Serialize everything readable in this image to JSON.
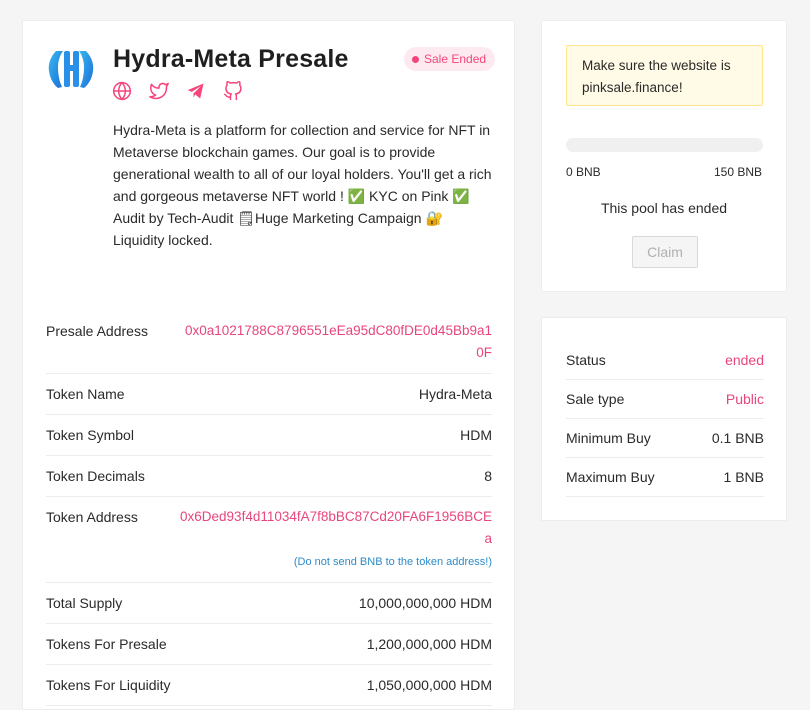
{
  "header": {
    "title": "Hydra-Meta Presale",
    "badge": "Sale Ended"
  },
  "colors": {
    "accent": "#f5457b",
    "link": "#2e8bc9",
    "warning_bg": "#fffbe6"
  },
  "socials": [
    "globe-icon",
    "twitter-icon",
    "telegram-icon",
    "github-icon"
  ],
  "description": "Hydra-Meta is a platform for collection and service for NFT in Metaverse blockchain games. Our goal is to provide generational wealth to all of our loyal holders. You'll get a rich and gorgeous metaverse NFT world ! ✅ KYC on Pink ✅ Audit by Tech-Audit 🗒Huge Marketing Campaign 🔐 Liquidity locked.",
  "info": {
    "presale_address_label": "Presale Address",
    "presale_address": "0x0a1021788C8796551eEa95dC80fDE0d45Bb9a10F",
    "token_name_label": "Token Name",
    "token_name": "Hydra-Meta",
    "token_symbol_label": "Token Symbol",
    "token_symbol": "HDM",
    "token_decimals_label": "Token Decimals",
    "token_decimals": "8",
    "token_address_label": "Token Address",
    "token_address": "0x6Ded93f4d11034fA7f8bBC87Cd20FA6F1956BCEa",
    "token_address_note": "(Do not send BNB to the token address!)",
    "total_supply_label": "Total Supply",
    "total_supply": "10,000,000,000 HDM",
    "tokens_presale_label": "Tokens For Presale",
    "tokens_presale": "1,200,000,000 HDM",
    "tokens_liquidity_label": "Tokens For Liquidity",
    "tokens_liquidity": "1,050,000,000 HDM"
  },
  "pool": {
    "warning": "Make sure the website is pinksale.finance!",
    "progress": 0,
    "min_label": "0 BNB",
    "max_label": "150 BNB",
    "ended_text": "This pool has ended",
    "claim_label": "Claim"
  },
  "status": {
    "status_label": "Status",
    "status_value": "ended",
    "sale_type_label": "Sale type",
    "sale_type_value": "Public",
    "min_buy_label": "Minimum Buy",
    "min_buy_value": "0.1 BNB",
    "max_buy_label": "Maximum Buy",
    "max_buy_value": "1 BNB"
  }
}
